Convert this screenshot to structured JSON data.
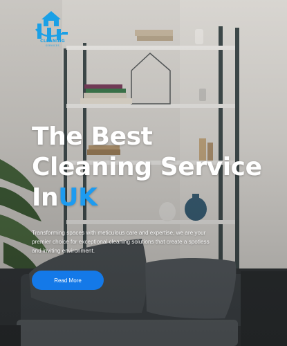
{
  "brand": {
    "logo_name": "CLEANING",
    "logo_tagline": "SERVICES"
  },
  "hero": {
    "title_line1": "The Best",
    "title_line2": "Cleaning Service",
    "title_line3_prefix": "In",
    "title_line3_accent": "UK",
    "description": "Transforming spaces with meticulous care and expertise, we are your premier choice for exceptional cleaning solutions that create a spotless and inviting environment.",
    "cta_label": "Read More"
  },
  "colors": {
    "accent": "#1d9bf0",
    "button": "#1479e8",
    "text": "#ffffff"
  },
  "icons": [
    "house-logo-icon"
  ]
}
